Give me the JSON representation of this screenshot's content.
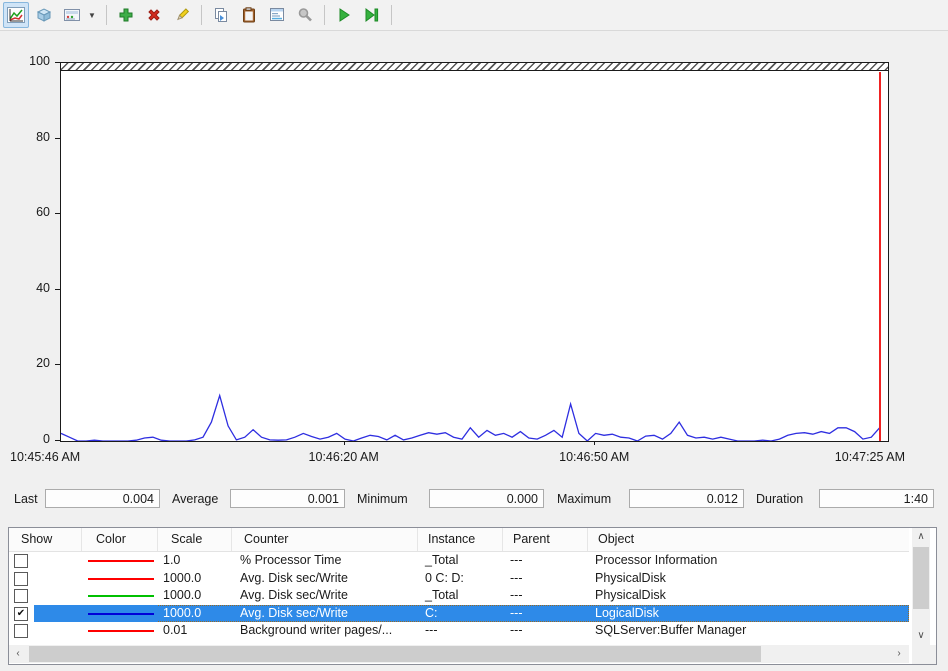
{
  "toolbar": {
    "buttons": [
      {
        "name": "view-graph",
        "selected": true
      },
      {
        "name": "view-histogram"
      },
      {
        "name": "view-report"
      },
      {
        "name": "change-graph-type-dropdown"
      },
      {
        "name": "add-counter"
      },
      {
        "name": "delete-counter"
      },
      {
        "name": "highlight"
      },
      {
        "name": "copy-properties"
      },
      {
        "name": "paste-counter-list"
      },
      {
        "name": "properties"
      },
      {
        "name": "zoom",
        "disabled": true
      },
      {
        "name": "freeze-display"
      },
      {
        "name": "update-data"
      }
    ]
  },
  "chart_data": {
    "type": "line",
    "title": "",
    "xlabel": "",
    "ylabel": "",
    "ylim": [
      0,
      100
    ],
    "y_ticks": [
      0,
      20,
      40,
      60,
      80,
      100
    ],
    "grid": false,
    "legend_position": "none",
    "duration_seconds": 99,
    "x_labels": [
      {
        "text": "10:45:46 AM",
        "fraction": 0
      },
      {
        "text": "10:46:20 AM",
        "fraction": 0.343
      },
      {
        "text": "10:46:50 AM",
        "fraction": 0.646
      },
      {
        "text": "10:47:25 AM",
        "fraction": 1
      }
    ],
    "time_marker_fraction": 0.989,
    "time_marker_color": "#f02222",
    "series": [
      {
        "name": "Avg. Disk sec/Write C: (scale 1000.0)",
        "color": "#2e2ee0",
        "points": [
          [
            0,
            2
          ],
          [
            1,
            1
          ],
          [
            2,
            0
          ],
          [
            3,
            0
          ],
          [
            4,
            0.2
          ],
          [
            5,
            0
          ],
          [
            6,
            0
          ],
          [
            7,
            0
          ],
          [
            8,
            0
          ],
          [
            9,
            0.2
          ],
          [
            10,
            0.8
          ],
          [
            11,
            1
          ],
          [
            12,
            0.2
          ],
          [
            13,
            0
          ],
          [
            14,
            0
          ],
          [
            15,
            0
          ],
          [
            16,
            0.3
          ],
          [
            17,
            1
          ],
          [
            18,
            5
          ],
          [
            19,
            12
          ],
          [
            20,
            4
          ],
          [
            21,
            0.3
          ],
          [
            22,
            1
          ],
          [
            23,
            3
          ],
          [
            24,
            1
          ],
          [
            25,
            0.3
          ],
          [
            26,
            0.2
          ],
          [
            27,
            0.3
          ],
          [
            28,
            1
          ],
          [
            29,
            2
          ],
          [
            30,
            1.2
          ],
          [
            31,
            0.5
          ],
          [
            32,
            1
          ],
          [
            33,
            2
          ],
          [
            34,
            0.5
          ],
          [
            35,
            0
          ],
          [
            36,
            0.8
          ],
          [
            37,
            1.5
          ],
          [
            38,
            1.2
          ],
          [
            39,
            0.3
          ],
          [
            40,
            1.5
          ],
          [
            41,
            0.3
          ],
          [
            42,
            0.8
          ],
          [
            43,
            1.5
          ],
          [
            44,
            2.2
          ],
          [
            45,
            1.8
          ],
          [
            46,
            2.2
          ],
          [
            47,
            1
          ],
          [
            48,
            0.5
          ],
          [
            49,
            3.5
          ],
          [
            50,
            1
          ],
          [
            51,
            2.8
          ],
          [
            52,
            1.5
          ],
          [
            53,
            2
          ],
          [
            54,
            1
          ],
          [
            55,
            2.5
          ],
          [
            56,
            0.8
          ],
          [
            57,
            0.5
          ],
          [
            58,
            1.5
          ],
          [
            59,
            2.8
          ],
          [
            60,
            1
          ],
          [
            61,
            9.8
          ],
          [
            62,
            2
          ],
          [
            63,
            0
          ],
          [
            64,
            2
          ],
          [
            65,
            1.5
          ],
          [
            66,
            1.8
          ],
          [
            67,
            1
          ],
          [
            68,
            0.8
          ],
          [
            69,
            0
          ],
          [
            70,
            1.3
          ],
          [
            71,
            1.5
          ],
          [
            72,
            0.5
          ],
          [
            73,
            2
          ],
          [
            74,
            5
          ],
          [
            75,
            1.5
          ],
          [
            76,
            0.8
          ],
          [
            77,
            1
          ],
          [
            78,
            0.5
          ],
          [
            79,
            1
          ],
          [
            80,
            0.5
          ],
          [
            81,
            0
          ],
          [
            82,
            0
          ],
          [
            83,
            0
          ],
          [
            84,
            0.2
          ],
          [
            85,
            0
          ],
          [
            86,
            0.5
          ],
          [
            87,
            1.5
          ],
          [
            88,
            2
          ],
          [
            89,
            2.2
          ],
          [
            90,
            1.8
          ],
          [
            91,
            2.5
          ],
          [
            92,
            2
          ],
          [
            93,
            3.5
          ],
          [
            94,
            3.5
          ],
          [
            95,
            2.5
          ],
          [
            96,
            0.5
          ],
          [
            97,
            1
          ],
          [
            98,
            3.5
          ]
        ]
      }
    ]
  },
  "stats": [
    {
      "label": "Last",
      "value": "0.004"
    },
    {
      "label": "Average",
      "value": "0.001"
    },
    {
      "label": "Minimum",
      "value": "0.000"
    },
    {
      "label": "Maximum",
      "value": "0.012"
    },
    {
      "label": "Duration",
      "value": "1:40"
    }
  ],
  "table": {
    "headers": [
      "Show",
      "Color",
      "Scale",
      "Counter",
      "Instance",
      "Parent",
      "Object"
    ],
    "selection_color": "#2e8ae8",
    "rows": [
      {
        "show": false,
        "color": "#ff0000",
        "scale": "1.0",
        "counter": "% Processor Time",
        "instance": "_Total",
        "parent": "---",
        "object": "Processor Information",
        "selected": false
      },
      {
        "show": false,
        "color": "#ff0000",
        "scale": "1000.0",
        "counter": "Avg. Disk sec/Write",
        "instance": "0 C: D:",
        "parent": "---",
        "object": "PhysicalDisk",
        "selected": false
      },
      {
        "show": false,
        "color": "#00c000",
        "scale": "1000.0",
        "counter": "Avg. Disk sec/Write",
        "instance": "_Total",
        "parent": "---",
        "object": "PhysicalDisk",
        "selected": false
      },
      {
        "show": true,
        "color": "#0000d8",
        "scale": "1000.0",
        "counter": "Avg. Disk sec/Write",
        "instance": "C:",
        "parent": "---",
        "object": "LogicalDisk",
        "selected": true
      },
      {
        "show": false,
        "color": "#ff0000",
        "scale": "0.01",
        "counter": "Background writer pages/...",
        "instance": "---",
        "parent": "---",
        "object": "SQLServer:Buffer Manager",
        "selected": false
      }
    ]
  },
  "scrollbars": {
    "up_arrow": "∧",
    "down_arrow": "∨",
    "left_arrow": "‹",
    "right_arrow": "›"
  }
}
